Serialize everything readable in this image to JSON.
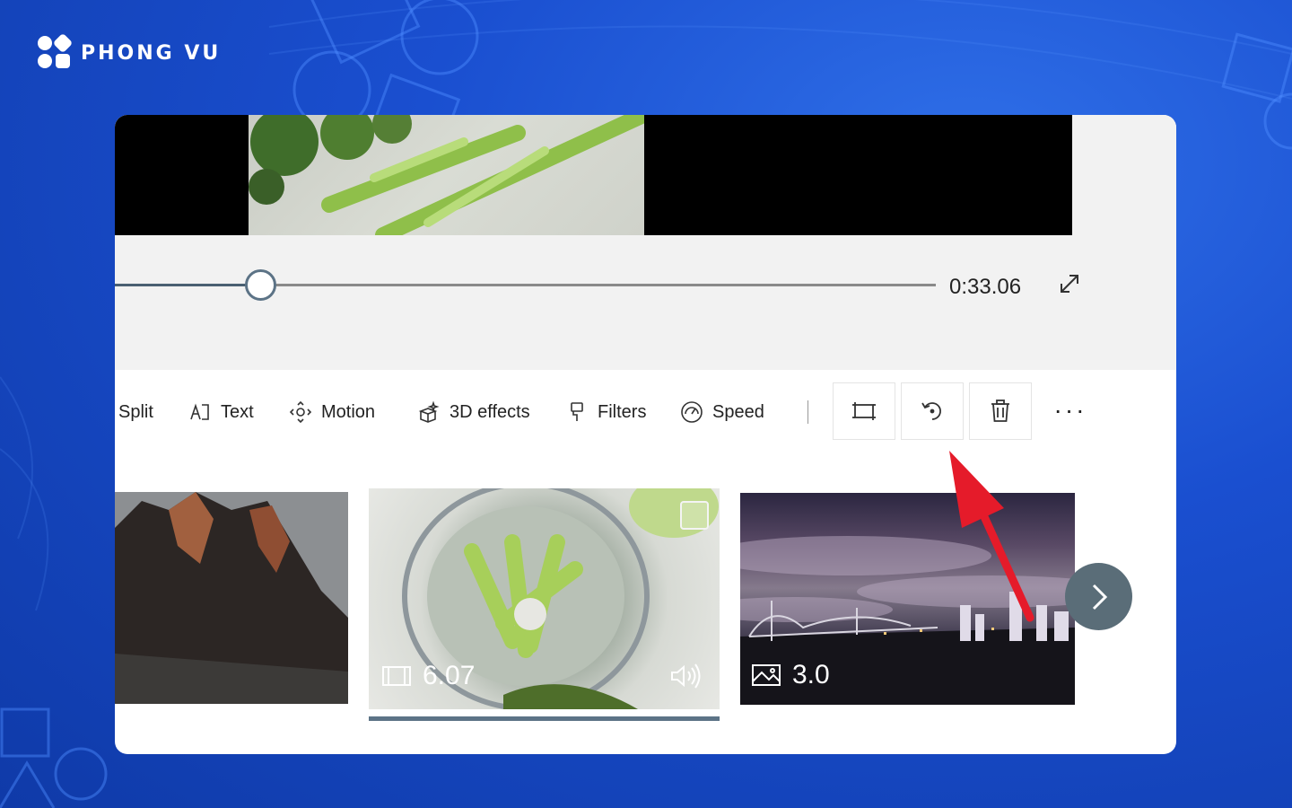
{
  "brand": {
    "name": "PHONG VU"
  },
  "player": {
    "time": "0:33.06",
    "progress": 0.18
  },
  "toolbar": {
    "split_label": "Split",
    "text_label": "Text",
    "motion_label": "Motion",
    "effects_label": "3D effects",
    "filters_label": "Filters",
    "speed_label": "Speed",
    "actions": [
      "crop-icon",
      "rotate-icon",
      "trash-icon",
      "more-icon"
    ],
    "more_label": "···"
  },
  "clips": [
    {
      "type": "image",
      "duration": ""
    },
    {
      "type": "video",
      "duration": "6.07",
      "audio": true,
      "selected": true
    },
    {
      "type": "image",
      "duration": "3.0"
    }
  ],
  "colors": {
    "accent": "#5c7386",
    "annotation": "#e51b2a",
    "background": "#1a4fd0"
  }
}
